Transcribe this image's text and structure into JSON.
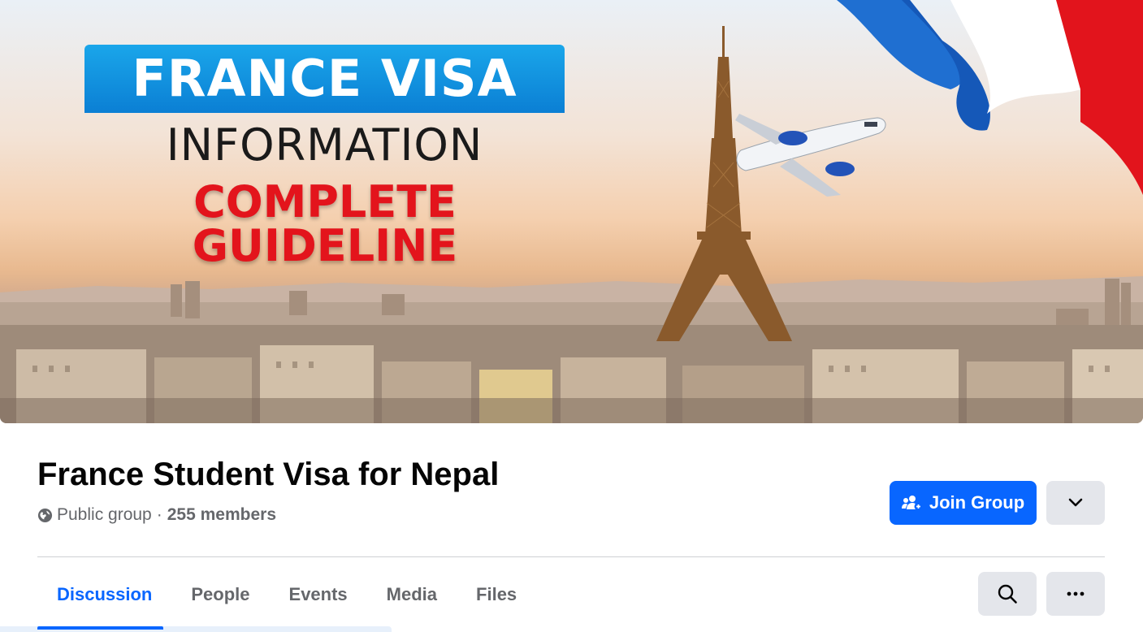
{
  "cover": {
    "headline": "FRANCE VISA",
    "line2": "INFORMATION",
    "line3": "COMPLETE GUIDELINE",
    "colors": {
      "banner_blue": "#0b7fd4",
      "headline_red": "#e3141c",
      "flag_blue": "#1f6fd1",
      "flag_white": "#ffffff",
      "flag_red": "#e2141c"
    }
  },
  "group": {
    "name": "France Student Visa for Nepal",
    "privacy_label": "Public group",
    "separator": "·",
    "members_label": "255 members",
    "privacy_icon": "globe-icon"
  },
  "actions": {
    "join_label": "Join Group",
    "join_icon": "people-icon",
    "more_icon": "chevron-down-icon",
    "search_icon": "search-icon",
    "options_icon": "ellipsis-icon"
  },
  "tabs": [
    {
      "label": "Discussion",
      "active": true
    },
    {
      "label": "People",
      "active": false
    },
    {
      "label": "Events",
      "active": false
    },
    {
      "label": "Media",
      "active": false
    },
    {
      "label": "Files",
      "active": false
    }
  ],
  "theme": {
    "accent": "#0866ff",
    "secondary_text": "#65676b",
    "primary_text": "#050505",
    "button_gray": "#e4e6eb"
  }
}
